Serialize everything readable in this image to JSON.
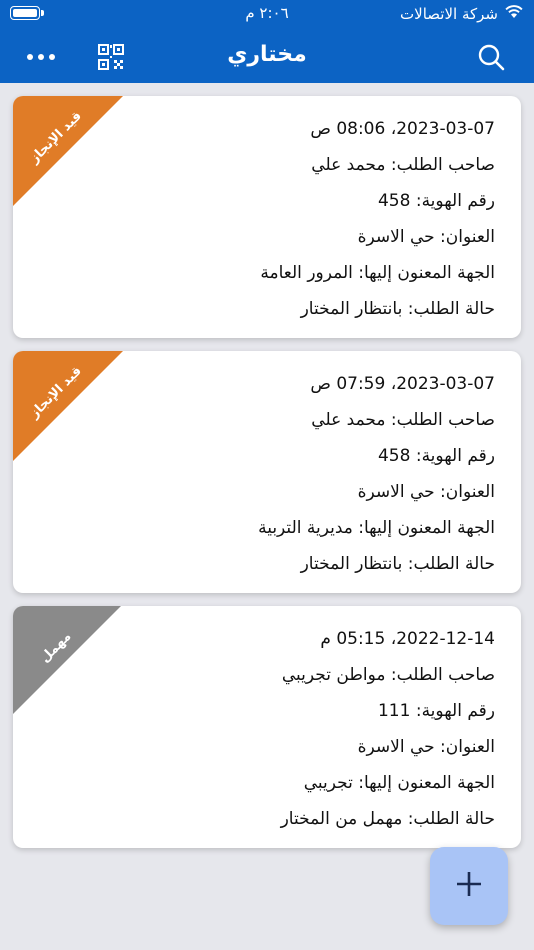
{
  "status_bar": {
    "carrier": "شركة الاتصالات",
    "time": "٢:٠٦ م",
    "battery_level": 1.0
  },
  "navbar": {
    "title": "مختاري",
    "icons": [
      "search-icon",
      "qr-code-icon",
      "more-dots-icon"
    ]
  },
  "colors": {
    "header": "#0c63c4",
    "in_progress": "#e07c27",
    "neglected": "#8a8a8a",
    "fab": "#a9c4f6"
  },
  "requests": [
    {
      "status_badge": "قيد الإنجاز",
      "datetime": "2023-03-07، 08:06 ص",
      "owner": "صاحب الطلب: محمد علي",
      "id_number": "رقم الهوية: 458",
      "address": "العنوان: حي الاسرة",
      "recipient": "الجهة المعنون إليها: المرور العامة",
      "state": "حالة الطلب: بانتظار المختار"
    },
    {
      "status_badge": "قيد الإنجاز",
      "datetime": "2023-03-07، 07:59 ص",
      "owner": "صاحب الطلب: محمد علي",
      "id_number": "رقم الهوية: 458",
      "address": "العنوان: حي الاسرة",
      "recipient": "الجهة المعنون إليها: مديرية التربية",
      "state": "حالة الطلب: بانتظار المختار"
    },
    {
      "status_badge": "مهمل",
      "datetime": "2022-12-14، 05:15 م",
      "owner": "صاحب الطلب: مواطن تجريبي",
      "id_number": "رقم الهوية: 111",
      "address": "العنوان: حي الاسرة",
      "recipient": "الجهة المعنون إليها: تجريبي",
      "state": "حالة الطلب: مهمل من المختار"
    }
  ],
  "fab": {
    "icon": "plus-icon"
  }
}
